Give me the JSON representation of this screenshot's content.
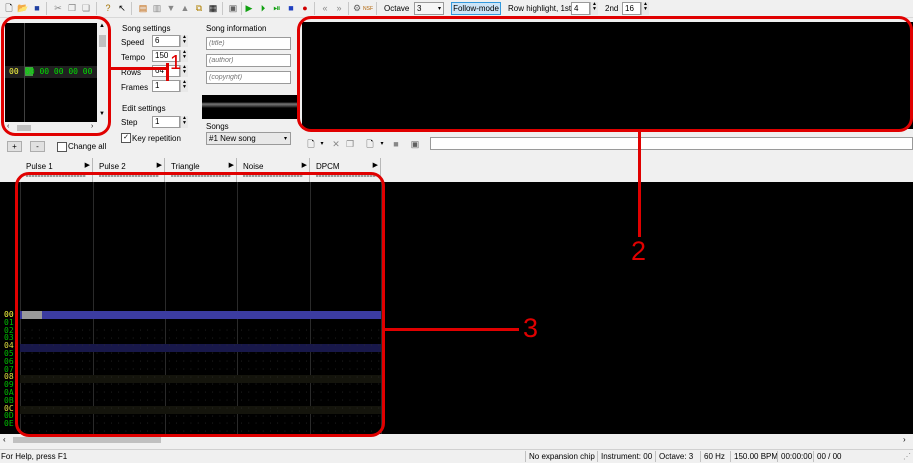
{
  "toolbar": {
    "octave_label": "Octave",
    "octave_value": "3",
    "follow_mode_label": "Follow-mode",
    "row_highlight_label": "Row highlight, 1st",
    "row_highlight_1st": "4",
    "row_highlight_2nd_label": "2nd",
    "row_highlight_2nd": "16",
    "nsf_label": "NSF"
  },
  "frame_box": {
    "row_index": "00",
    "frame_values": "00 00 00 00 00"
  },
  "frame_buttons": {
    "add": "+",
    "remove": "-",
    "change_all": "Change all"
  },
  "song_settings": {
    "title": "Song settings",
    "speed_label": "Speed",
    "speed": "6",
    "tempo_label": "Tempo",
    "tempo": "150",
    "rows_label": "Rows",
    "rows": "64",
    "frames_label": "Frames",
    "frames": "1"
  },
  "edit_settings": {
    "title": "Edit settings",
    "step_label": "Step",
    "step": "1",
    "key_repetition": "Key repetition"
  },
  "song_information": {
    "title": "Song information",
    "title_placeholder": "(title)",
    "author_placeholder": "(author)",
    "copyright_placeholder": "(copyright)"
  },
  "songs": {
    "label": "Songs",
    "selected": "#1 New song"
  },
  "channels": [
    "Pulse 1",
    "Pulse 2",
    "Triangle",
    "Noise",
    "DPCM"
  ],
  "rows": [
    "00",
    "01",
    "02",
    "03",
    "04",
    "05",
    "06",
    "07",
    "08",
    "09",
    "0A",
    "0B",
    "0C",
    "0D",
    "0E"
  ],
  "annotations": {
    "one": "1",
    "two": "2",
    "three": "3"
  },
  "statusbar": {
    "help": "For Help, press F1",
    "chip": "No expansion chip",
    "instrument": "Instrument: 00",
    "octave": "Octave: 3",
    "rate": "60 Hz",
    "bpm": "150.00 BPM",
    "time": "00:00:00",
    "position": "00 / 00"
  }
}
